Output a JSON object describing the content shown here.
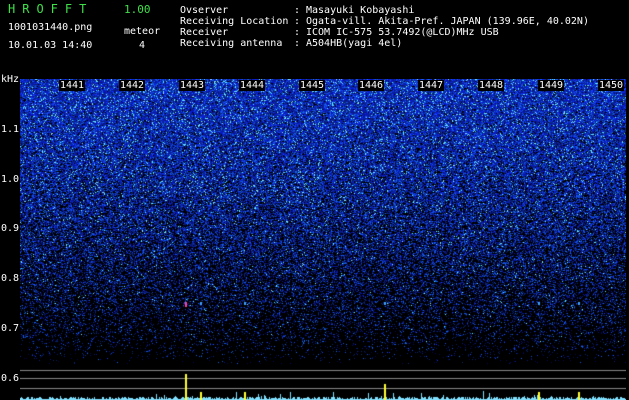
{
  "header": {
    "app_title": "HROFFT",
    "version": "1.00",
    "filename": "1001031440.png",
    "datetime": "10.01.03 14:40",
    "meteor_label": "meteor",
    "meteor_count": "4"
  },
  "info": [
    {
      "label": "Ovserver",
      "sep": ":",
      "value": "Masayuki Kobayashi"
    },
    {
      "label": "Receiving Location",
      "sep": ":",
      "value": "Ogata-vill. Akita-Pref. JAPAN (139.96E, 40.02N)"
    },
    {
      "label": "Receiver",
      "sep": ":",
      "value": "ICOM IC-575 53.7492(@LCD)MHz USB"
    },
    {
      "label": "Receiving antenna",
      "sep": ":",
      "value": "A504HB(yagi 4el)"
    }
  ],
  "spectrogram": {
    "y_unit": "kHz",
    "y_ticks": [
      "1.1",
      "1.0",
      "0.9",
      "0.8",
      "0.7",
      "0.6"
    ],
    "y_range_khz": [
      0.58,
      1.2
    ],
    "time_labels": [
      "1441",
      "1442",
      "1443",
      "1444",
      "1445",
      "1446",
      "1447",
      "1448",
      "1449",
      "1450"
    ],
    "meteor_minutes_offset": [
      2.72,
      2.97,
      3.7,
      6.0,
      8.55,
      9.2
    ],
    "colors": {
      "noise_dark": "#000a30",
      "noise_mid": "#1a2cff",
      "noise_bright": "#4fe0ff",
      "meteor_echo": "#ff40a0",
      "baseline": "#80e0ff",
      "spike": "#ffff30",
      "ref_line": "#c0c0c0"
    }
  }
}
